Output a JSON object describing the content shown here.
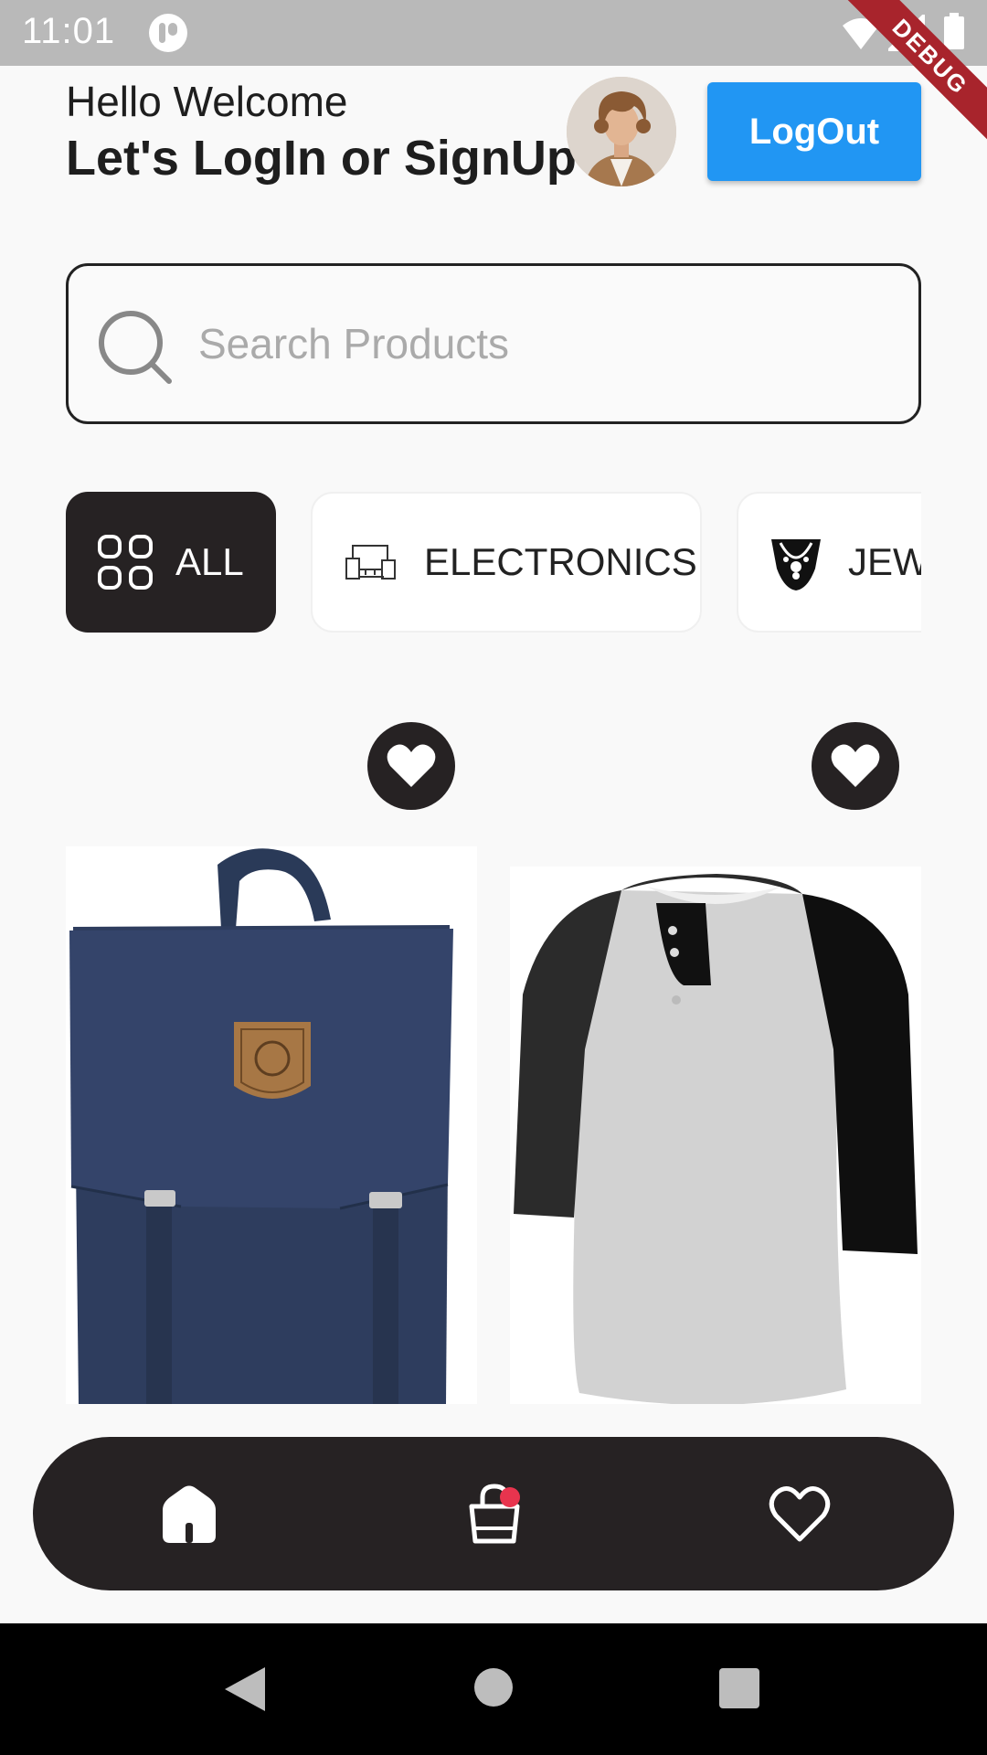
{
  "status_bar": {
    "time": "11:01",
    "debug_label": "DEBUG"
  },
  "header": {
    "greeting": "Hello Welcome",
    "headline": "Let's LogIn or SignUp",
    "logout_label": "LogOut"
  },
  "search": {
    "placeholder": "Search Products",
    "value": ""
  },
  "categories": [
    {
      "label": "ALL",
      "icon": "grid-icon",
      "selected": true
    },
    {
      "label": "ELECTRONICS",
      "icon": "devices-icon",
      "selected": false
    },
    {
      "label": "JEW",
      "icon": "necklace-icon",
      "selected": false
    }
  ],
  "products": [
    {
      "image": "navy-backpack",
      "favorite_icon": "heart-icon"
    },
    {
      "image": "raglan-henley-shirt",
      "favorite_icon": "heart-icon"
    }
  ],
  "bottom_nav": [
    {
      "icon": "home-icon",
      "active": true
    },
    {
      "icon": "cart-icon",
      "badge": true
    },
    {
      "icon": "heart-outline-icon",
      "active": false
    }
  ],
  "colors": {
    "accent": "#2196f3",
    "dark": "#262223",
    "badge": "#e8344e",
    "background": "#f9f9f9"
  }
}
